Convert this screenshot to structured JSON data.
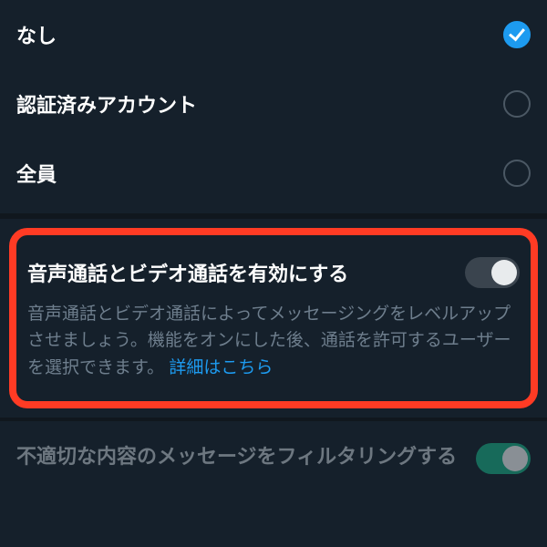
{
  "radioGroup": {
    "items": [
      {
        "label": "なし",
        "selected": true
      },
      {
        "label": "認証済みアカウント",
        "selected": false
      },
      {
        "label": "全員",
        "selected": false
      }
    ]
  },
  "callsSection": {
    "title": "音声通話とビデオ通話を有効にする",
    "enabled": false,
    "description": "音声通話とビデオ通話によってメッセージングをレベルアップさせましょう。機能をオンにした後、通話を許可するユーザーを選択できます。",
    "linkText": "詳細はこちら"
  },
  "filterSection": {
    "title": "不適切な内容のメッセージをフィルタリングする",
    "enabled": true
  }
}
